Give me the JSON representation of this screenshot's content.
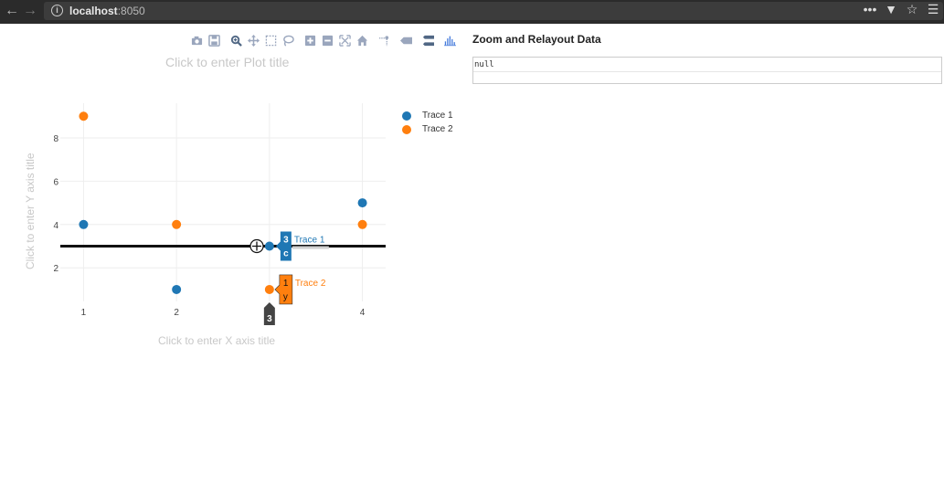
{
  "browser": {
    "host": "localhost",
    "port": ":8050"
  },
  "modebar": {
    "icons": [
      "camera-icon",
      "save-icon",
      "zoom-icon",
      "pan-icon",
      "box-select-icon",
      "lasso-icon",
      "zoom-in-icon",
      "zoom-out-icon",
      "autoscale-icon",
      "reset-axes-icon",
      "spike-lines-icon",
      "hover-closest-icon",
      "hover-compare-icon",
      "plotly-logo-icon"
    ]
  },
  "right_panel": {
    "title": "Zoom and Relayout Data",
    "output": "null"
  },
  "plot": {
    "title_placeholder": "Click to enter Plot title",
    "xlabel_placeholder": "Click to enter X axis title",
    "ylabel_placeholder": "Click to enter Y axis title",
    "hover_x_label": "3",
    "hover_labels": [
      {
        "name": "Trace 1",
        "value": "3",
        "category": "c"
      },
      {
        "name": "Trace 2",
        "value": "1",
        "category": "y"
      }
    ]
  },
  "colors": {
    "trace1": "#1f77b4",
    "trace2": "#ff7f0e",
    "grid": "#eeeeee",
    "tick": "#444444"
  },
  "chart_data": {
    "type": "scatter",
    "x": [
      1,
      2,
      3,
      4
    ],
    "series": [
      {
        "name": "Trace 1",
        "values": [
          4,
          1,
          3,
          5
        ]
      },
      {
        "name": "Trace 2",
        "values": [
          9,
          4,
          1,
          4
        ]
      }
    ],
    "xlim": [
      0.75,
      4.25
    ],
    "ylim": [
      0.45,
      9.6
    ],
    "xticks": [
      1,
      2,
      3,
      4
    ],
    "yticks": [
      2,
      4,
      6,
      8
    ],
    "spikeline_y": 3,
    "grid": true,
    "legend": "top-right",
    "title": "",
    "xlabel": "",
    "ylabel": ""
  }
}
